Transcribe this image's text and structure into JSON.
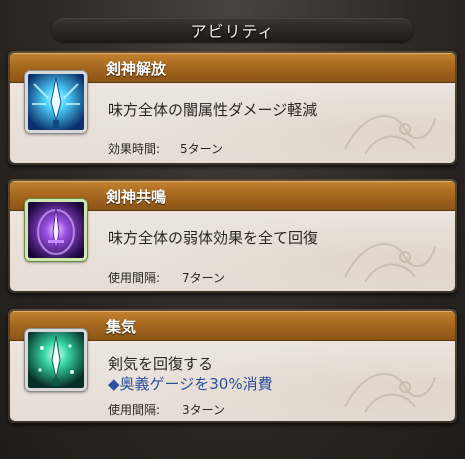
{
  "header": {
    "title": "アビリティ"
  },
  "abilities": [
    {
      "name": "剣神解放",
      "description": "味方全体の闇属性ダメージ軽減",
      "extra": "",
      "time_label": "効果時間:",
      "time_value": "5ターン",
      "icon": "blue-sword-burst-icon",
      "icon_colors": {
        "bg": "#0b3a7a",
        "glow": "#9ff2ff"
      }
    },
    {
      "name": "剣神共鳴",
      "description": "味方全体の弱体効果を全て回復",
      "extra": "",
      "time_label": "使用間隔:",
      "time_value": "7ターン",
      "icon": "purple-sword-aura-icon",
      "icon_colors": {
        "bg": "#2b0a55",
        "glow": "#d9a7ff"
      }
    },
    {
      "name": "集気",
      "description": "剣気を回復する",
      "extra": "◆奥義ゲージを30%消費",
      "time_label": "使用間隔:",
      "time_value": "3ターン",
      "icon": "green-sword-spirit-icon",
      "icon_colors": {
        "bg": "#0b3b36",
        "glow": "#9cffd5"
      }
    }
  ]
}
